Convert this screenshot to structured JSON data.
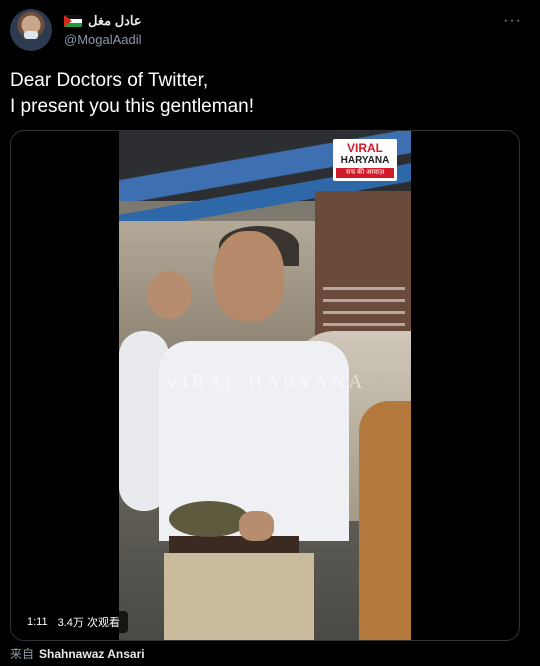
{
  "author": {
    "display_name": "عادل مغل",
    "handle": "@MogalAadil",
    "flag_icon": "palestine-flag-icon",
    "avatar_icon": "avatar-icon"
  },
  "menu": {
    "icon": "more-options-icon",
    "label": "···"
  },
  "tweet": {
    "line1": "Dear Doctors of Twitter,",
    "line2": "I present you this gentleman!"
  },
  "media": {
    "type": "video",
    "duration": "1:11",
    "views": "3.4万 次观看",
    "watermark": "VIRAL HARYANA",
    "logo": {
      "line1": "VIRAL",
      "line2": "HARYANA",
      "line3": "सच की आवाज़"
    }
  },
  "footer": {
    "prefix": "来自",
    "source": "Shahnawaz Ansari"
  },
  "colors": {
    "background": "#000000",
    "muted": "#8b98a5",
    "text": "#e7e9ea",
    "border": "#2f3336",
    "logo_red": "#d11a2a"
  }
}
